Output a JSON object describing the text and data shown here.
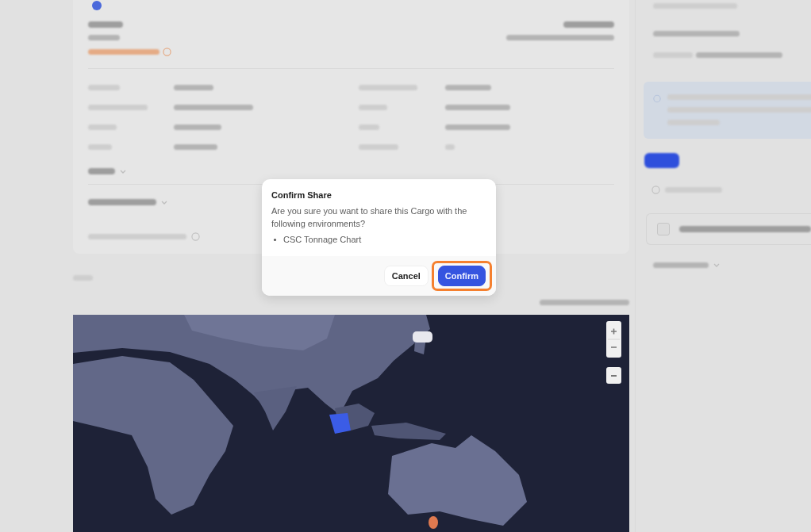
{
  "dialog": {
    "title": "Confirm Share",
    "message": "Are you sure you want to share this Cargo with the following environments?",
    "environments": [
      "CSC Tonnage Chart"
    ],
    "buttons": [
      {
        "label": "Cancel",
        "kind": "secondary",
        "highlighted": false
      },
      {
        "label": "Confirm",
        "kind": "primary",
        "highlighted": true
      }
    ]
  }
}
